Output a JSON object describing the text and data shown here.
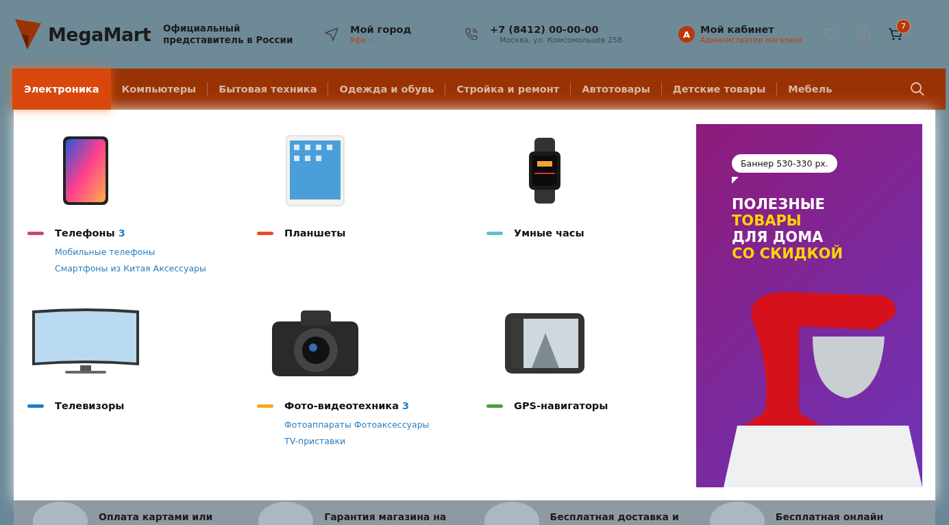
{
  "header": {
    "logo": "MegaMart",
    "tagline": "Официальный представитель в России",
    "city": {
      "label": "Мой город",
      "value": "Уфа"
    },
    "phone": {
      "number": "+7 (8412) 00-00-00",
      "address": "Москва, ул. Комсомольцев 258"
    },
    "account": {
      "initial": "А",
      "title": "Мой кабинет",
      "role": "Администратор магазина"
    },
    "cart_count": "7"
  },
  "nav": [
    {
      "label": "Электроника",
      "selected": true
    },
    {
      "label": "Компьютеры",
      "selected": false
    },
    {
      "label": "Бытовая техника",
      "selected": false
    },
    {
      "label": "Одежда и обувь",
      "selected": false
    },
    {
      "label": "Стройка и ремонт",
      "selected": false
    },
    {
      "label": "Автотовары",
      "selected": false
    },
    {
      "label": "Детские товары",
      "selected": false
    },
    {
      "label": "Мебель",
      "selected": false
    }
  ],
  "categories": [
    {
      "kind": "phone",
      "name": "Телефоны",
      "count": "3",
      "color": "#c9447c",
      "links": [
        "Мобильные телефоны",
        "Смартфоны из Китая",
        "Аксессуары"
      ]
    },
    {
      "kind": "tablet",
      "name": "Планшеты",
      "color": "#ec4a2c"
    },
    {
      "kind": "watch",
      "name": "Умные часы",
      "color": "#5bc2c9"
    },
    {
      "kind": "tv",
      "name": "Телевизоры",
      "color": "#1b7fcb"
    },
    {
      "kind": "camera",
      "name": "Фото-видеотехника",
      "count": "3",
      "color": "#f6a821",
      "links": [
        "Фотоаппараты",
        "Фотоаксессуары",
        "TV-приставки"
      ]
    },
    {
      "kind": "gps",
      "name": "GPS-навигаторы",
      "color": "#4e9c43"
    }
  ],
  "banner": {
    "bubble": "Баннер 530-330 рх.",
    "lines": [
      {
        "text": "ПОЛЕЗНЫЕ",
        "highlight": false
      },
      {
        "text": "ТОВАРЫ",
        "highlight": true
      },
      {
        "text": "ДЛЯ ДОМА",
        "highlight": false
      },
      {
        "text": "СО СКИДКОЙ",
        "highlight": true
      }
    ]
  },
  "features": [
    "Оплата картами или",
    "Гарантия магазина на",
    "Бесплатная доставка и",
    "Бесплатная онлайн"
  ]
}
